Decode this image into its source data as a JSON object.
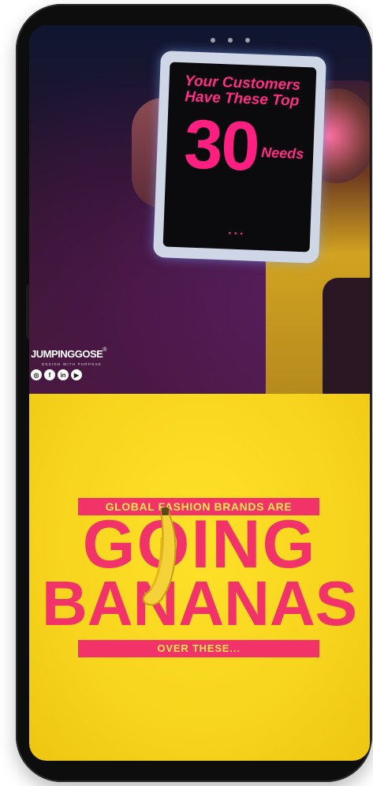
{
  "top_post": {
    "tablet_line1": "Your Customers",
    "tablet_line2": "Have These Top",
    "tablet_number": "30",
    "tablet_needs": "Needs",
    "tablet_dots": "...",
    "brand_name": "JUMPINGGOSE",
    "brand_mark": "®",
    "brand_tagline": "DESIGN WITH PURPOSE",
    "social_icons": [
      "instagram-icon",
      "facebook-icon",
      "linkedin-icon",
      "youtube-icon"
    ],
    "social_glyphs": [
      "◎",
      "f",
      "in",
      "▶"
    ]
  },
  "bottom_post": {
    "headline_top": "GLOBAL FASHION BRANDS ARE",
    "headline_going": "GOING",
    "headline_bananas": "BANANAS",
    "headline_bottom": "OVER THESE..."
  },
  "colors": {
    "accent_pink": "#f2336a",
    "banner_yellow": "#f7d41d",
    "tablet_text_pink": "#ff2d86"
  }
}
